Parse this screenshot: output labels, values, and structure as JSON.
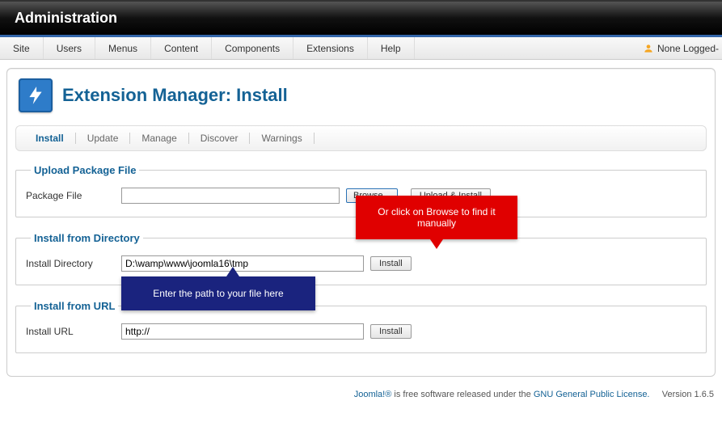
{
  "header": {
    "title": "Administration"
  },
  "menu": {
    "items": [
      "Site",
      "Users",
      "Menus",
      "Content",
      "Components",
      "Extensions",
      "Help"
    ],
    "login_status": "None Logged-"
  },
  "page": {
    "title": "Extension Manager: Install",
    "icon": "lightning-plug-icon"
  },
  "tabs": [
    "Install",
    "Update",
    "Manage",
    "Discover",
    "Warnings"
  ],
  "tabs_active_index": 0,
  "sections": {
    "upload": {
      "legend": "Upload Package File",
      "label": "Package File",
      "value": "",
      "browse_label": "Browse...",
      "submit_label": "Upload & Install"
    },
    "directory": {
      "legend": "Install from Directory",
      "label": "Install Directory",
      "value": "D:\\wamp\\www\\joomla16\\tmp",
      "submit_label": "Install"
    },
    "url": {
      "legend": "Install from URL",
      "label": "Install URL",
      "value": "http://",
      "submit_label": "Install"
    }
  },
  "callouts": {
    "red": "Or click on Browse to find it manually",
    "blue": "Enter the path to your file here"
  },
  "footer": {
    "prefix": "Joomla!®",
    "text": " is free software released under the ",
    "link": "GNU General Public License.",
    "version_label": "Version ",
    "version": "1.6.5"
  }
}
